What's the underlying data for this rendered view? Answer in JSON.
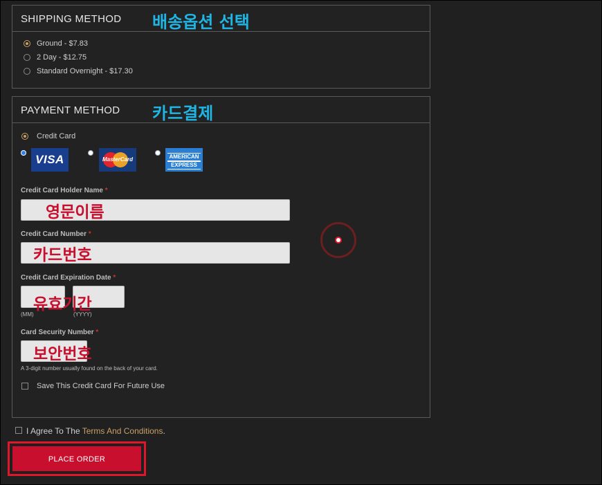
{
  "shipping": {
    "title": "SHIPPING METHOD",
    "note": "배송옵션 선택",
    "options": [
      {
        "label": "Ground - $7.83",
        "checked": true
      },
      {
        "label": "2 Day - $12.75",
        "checked": false
      },
      {
        "label": "Standard Overnight - $17.30",
        "checked": false
      }
    ]
  },
  "payment": {
    "title": "PAYMENT METHOD",
    "note": "카드결제",
    "method_label": "Credit Card",
    "cards": {
      "visa": "VISA",
      "mastercard": "MasterCard",
      "amex_line1": "AMERICAN",
      "amex_line2": "EXPRESS"
    },
    "holder_label": "Credit Card Holder Name",
    "holder_note": "영문이름",
    "number_label": "Credit Card Number",
    "number_note": "카드번호",
    "expiration_label": "Credit Card Expiration Date",
    "expiration_note": "유효기간",
    "mm_hint": "(MM)",
    "yyyy_hint": "(YYYY)",
    "cvv_label": "Card Security Number",
    "cvv_note": "보안번호",
    "cvv_hint": "A 3-digit number usually found on the back of your card.",
    "save_label": "Save This Credit Card For Future Use",
    "required_mark": "*"
  },
  "agree": {
    "prefix": "I Agree To The ",
    "link": "Terms And Conditions",
    "suffix": "."
  },
  "place_order": "PLACE ORDER",
  "colors": {
    "accent_red": "#c8102e",
    "note_blue": "#1fb6e6",
    "link_gold": "#c9a067"
  }
}
